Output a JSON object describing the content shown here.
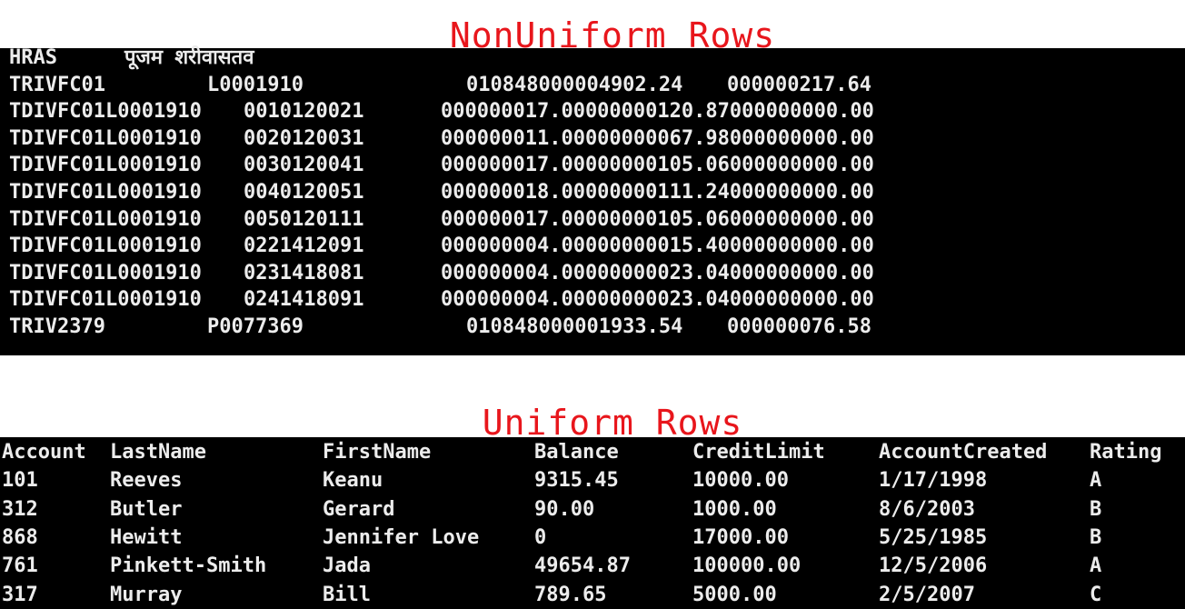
{
  "nonuniform": {
    "title": "NonUniform Rows",
    "rows": [
      [
        "HRAS",
        "पूजम शरीवासतव",
        "",
        ""
      ],
      [
        "TRIVFC01",
        "L0001910",
        "010848000004902.24",
        "000000217.64"
      ],
      [
        "TDIVFC01L0001910",
        "0010120021",
        "000000017.00000000120.87000000000.00",
        ""
      ],
      [
        "TDIVFC01L0001910",
        "0020120031",
        "000000011.00000000067.98000000000.00",
        ""
      ],
      [
        "TDIVFC01L0001910",
        "0030120041",
        "000000017.00000000105.06000000000.00",
        ""
      ],
      [
        "TDIVFC01L0001910",
        "0040120051",
        "000000018.00000000111.24000000000.00",
        ""
      ],
      [
        "TDIVFC01L0001910",
        "0050120111",
        "000000017.00000000105.06000000000.00",
        ""
      ],
      [
        "TDIVFC01L0001910",
        "0221412091",
        "000000004.00000000015.40000000000.00",
        ""
      ],
      [
        "TDIVFC01L0001910",
        "0231418081",
        "000000004.00000000023.04000000000.00",
        ""
      ],
      [
        "TDIVFC01L0001910",
        "0241418091",
        "000000004.00000000023.04000000000.00",
        ""
      ],
      [
        "TRIV2379",
        "P0077369",
        "010848000001933.54",
        "000000076.58"
      ]
    ]
  },
  "uniform": {
    "title": "Uniform Rows",
    "headers": [
      "Account",
      "LastName",
      "FirstName",
      "Balance",
      "CreditLimit",
      "AccountCreated",
      "Rating"
    ],
    "rows": [
      [
        "101",
        "Reeves",
        "Keanu",
        "9315.45",
        "10000.00",
        "1/17/1998",
        "A"
      ],
      [
        "312",
        "Butler",
        "Gerard",
        "90.00",
        "1000.00",
        "8/6/2003",
        "B"
      ],
      [
        "868",
        "Hewitt",
        "Jennifer Love",
        "0",
        "17000.00",
        "5/25/1985",
        "B"
      ],
      [
        "761",
        "Pinkett-Smith",
        "Jada",
        "49654.87",
        "100000.00",
        "12/5/2006",
        "A"
      ],
      [
        "317",
        "Murray",
        "Bill",
        "789.65",
        "5000.00",
        "2/5/2007",
        "C"
      ]
    ]
  }
}
